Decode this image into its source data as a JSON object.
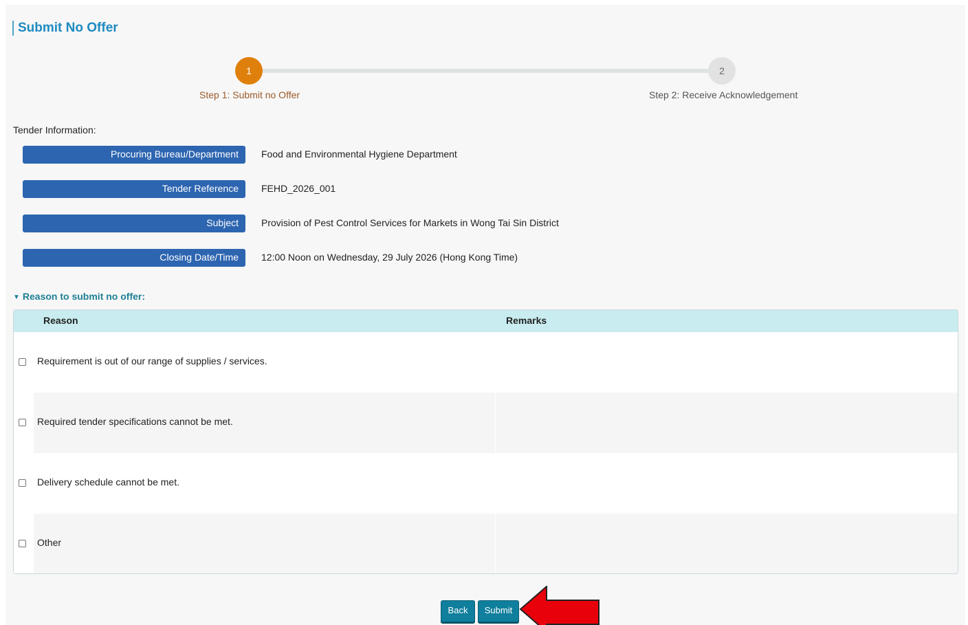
{
  "page": {
    "title": "Submit No Offer"
  },
  "stepper": {
    "steps": [
      {
        "number": "1",
        "label": "Step 1: Submit no Offer",
        "active": true
      },
      {
        "number": "2",
        "label": "Step 2: Receive Acknowledgement",
        "active": false
      }
    ]
  },
  "tender": {
    "section_label": "Tender Information:",
    "fields": [
      {
        "key": "Procuring Bureau/Department",
        "value": "Food and Environmental Hygiene Department"
      },
      {
        "key": "Tender Reference",
        "value": "FEHD_2026_001"
      },
      {
        "key": "Subject",
        "value": "Provision of Pest Control Services for Markets in Wong Tai Sin District"
      },
      {
        "key": "Closing Date/Time",
        "value": "12:00 Noon on Wednesday, 29 July 2026 (Hong Kong Time)"
      }
    ]
  },
  "reasons": {
    "toggle_label": "Reason to submit no offer:",
    "headers": {
      "reason": "Reason",
      "remarks": "Remarks"
    },
    "rows": [
      {
        "label": "Requirement is out of our range of supplies / services.",
        "checked": false,
        "remarks": ""
      },
      {
        "label": "Required tender specifications cannot be met.",
        "checked": false,
        "remarks": ""
      },
      {
        "label": "Delivery schedule cannot be met.",
        "checked": false,
        "remarks": ""
      },
      {
        "label": "Other",
        "checked": false,
        "remarks": ""
      }
    ]
  },
  "actions": {
    "back_label": "Back",
    "submit_label": "Submit"
  },
  "colors": {
    "accent": "#1f8ac0",
    "step_active": "#e0800c",
    "key_bg": "#2d65b0",
    "table_header": "#c8ecef",
    "button": "#0f7f9d",
    "arrow": "#e8000b"
  },
  "icons": {
    "toggle": "caret-down-icon",
    "pointer": "red-arrow-icon"
  }
}
